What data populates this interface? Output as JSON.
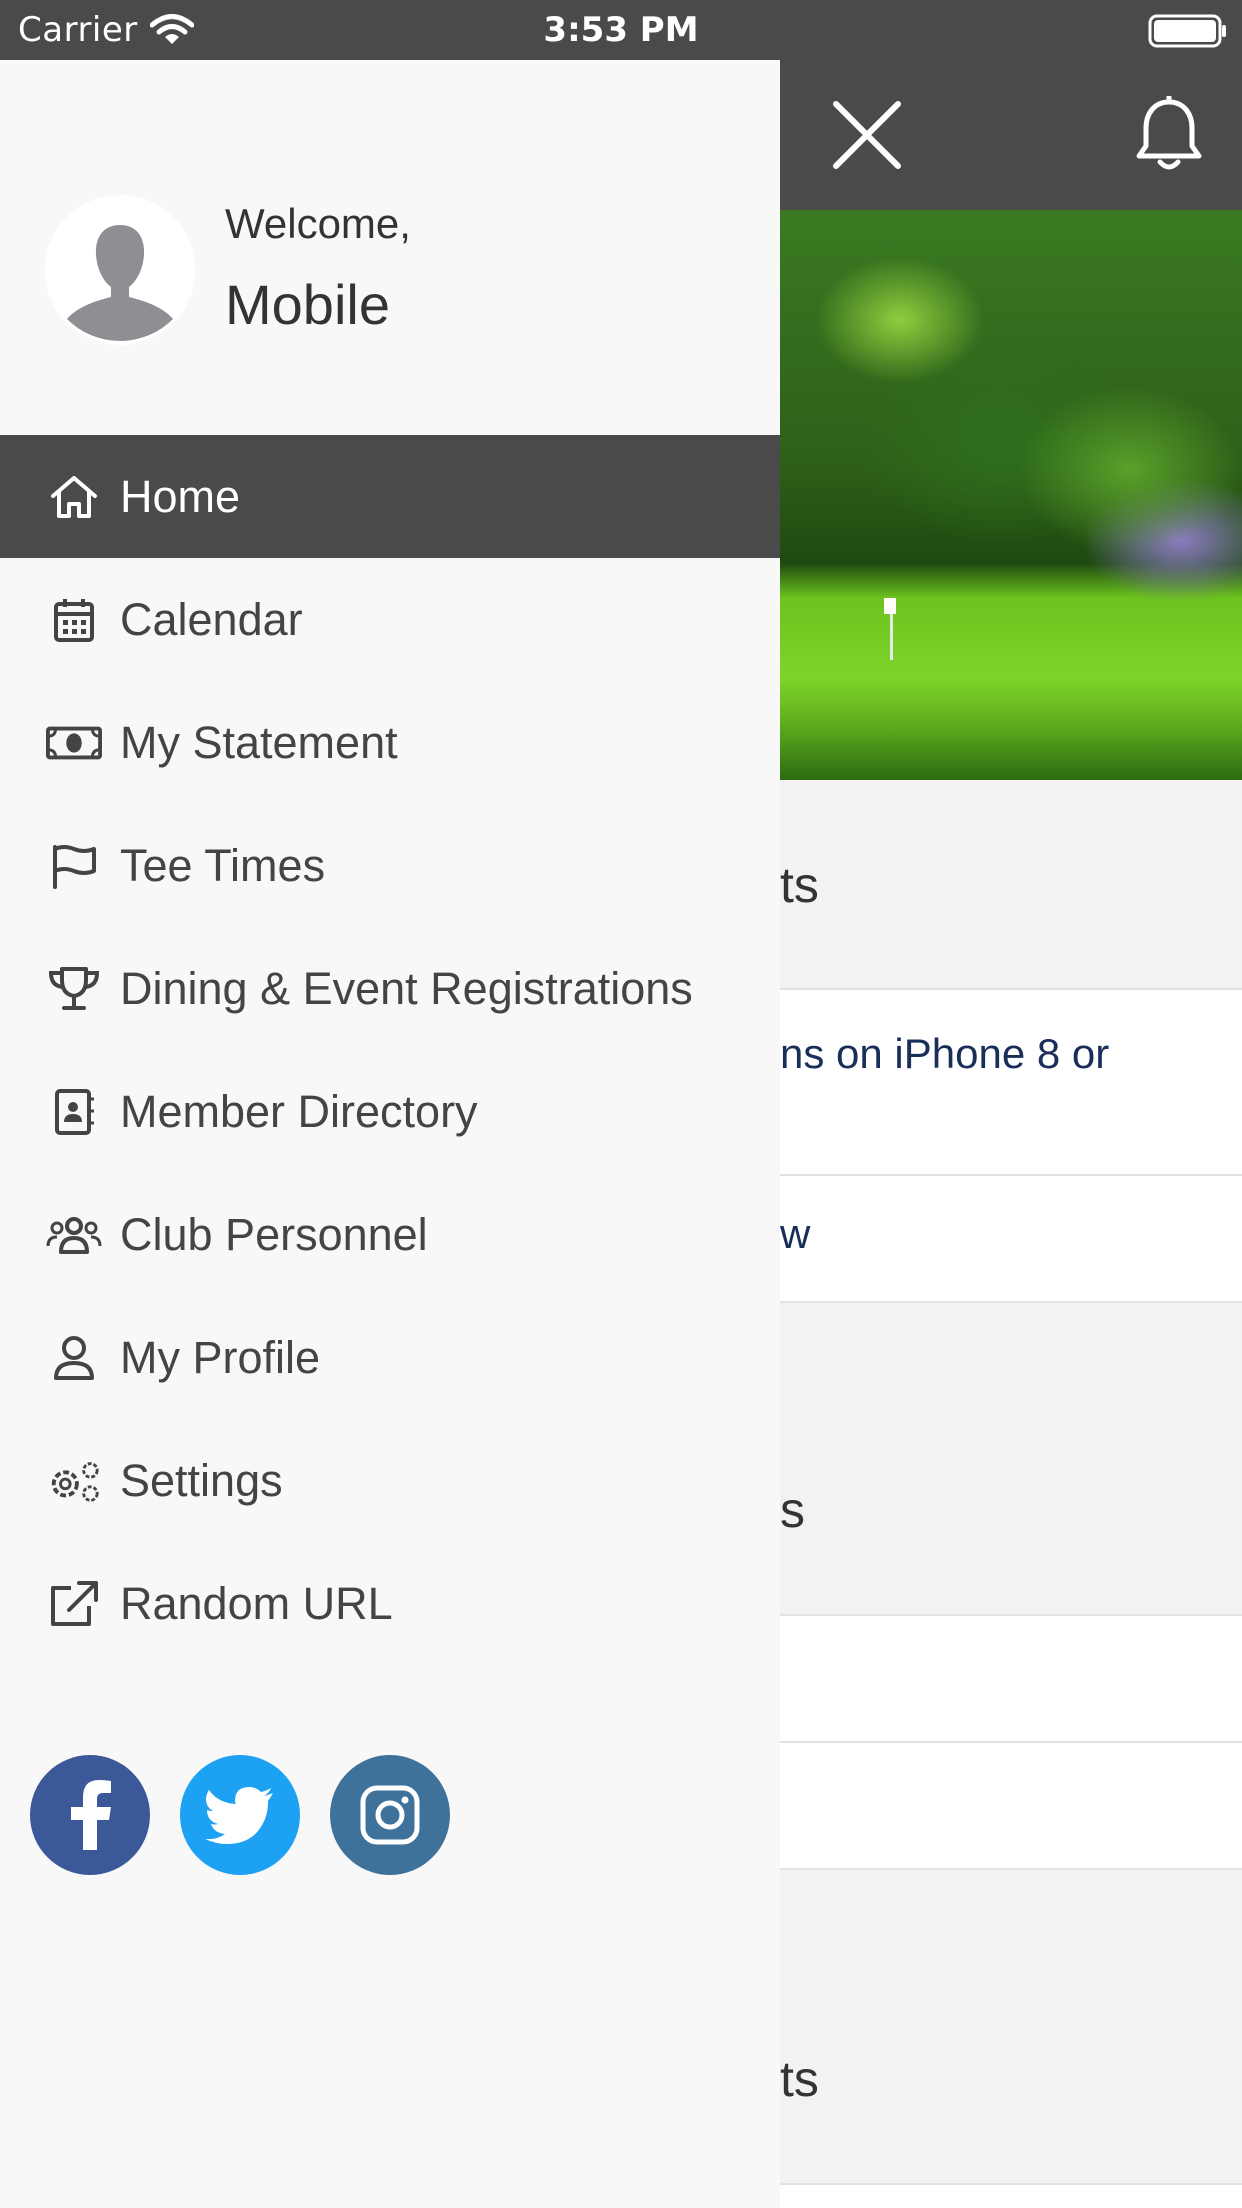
{
  "status_bar": {
    "carrier": "Carrier",
    "time": "3:53 PM"
  },
  "drawer": {
    "welcome_label": "Welcome,",
    "username": "Mobile",
    "menu": [
      {
        "label": "Home",
        "icon": "home-icon",
        "active": true
      },
      {
        "label": "Calendar",
        "icon": "calendar-icon",
        "active": false
      },
      {
        "label": "My Statement",
        "icon": "money-bill-icon",
        "active": false
      },
      {
        "label": "Tee Times",
        "icon": "flag-icon",
        "active": false
      },
      {
        "label": "Dining & Event Registrations",
        "icon": "trophy-icon",
        "active": false
      },
      {
        "label": "Member Directory",
        "icon": "address-book-icon",
        "active": false
      },
      {
        "label": "Club Personnel",
        "icon": "users-icon",
        "active": false
      },
      {
        "label": "My Profile",
        "icon": "user-icon",
        "active": false
      },
      {
        "label": "Settings",
        "icon": "cogs-icon",
        "active": false
      },
      {
        "label": "Random URL",
        "icon": "external-link-icon",
        "active": false
      }
    ],
    "socials": [
      {
        "name": "facebook-icon",
        "color": "#3b5998"
      },
      {
        "name": "twitter-icon",
        "color": "#1da1f2"
      },
      {
        "name": "instagram-icon",
        "color": "#3f729b"
      }
    ]
  },
  "background": {
    "section1_fragment": "ts",
    "row1_fragment": "ns on iPhone 8 or",
    "row2_fragment": "w",
    "section2_fragment": "s",
    "section3_fragment": "ts"
  },
  "colors": {
    "header": "#4a4a4a",
    "drawer_bg": "#f8f8f8",
    "active_item": "#4a4a4a",
    "link": "#1a2e5a"
  }
}
